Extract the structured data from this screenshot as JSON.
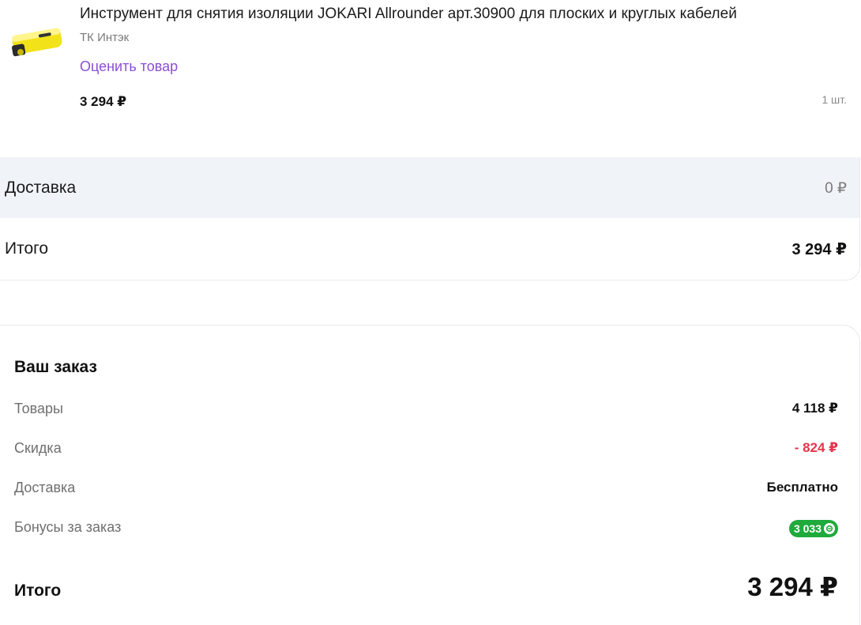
{
  "product": {
    "title": "Инструмент для снятия изоляции JOKARI Allrounder арт.30900 для плоских и круглых кабелей",
    "seller": "ТК Интэк",
    "rate_link": "Оценить товар",
    "price": "3 294 ₽",
    "quantity": "1 шт.",
    "image_icon": "cable-stripper-tool-image"
  },
  "summary": {
    "delivery_label": "Доставка",
    "delivery_value": "0 ₽",
    "total_label": "Итого",
    "total_value": "3 294 ₽"
  },
  "order": {
    "title": "Ваш заказ",
    "lines": [
      {
        "label": "Товары",
        "value": "4 118 ₽"
      },
      {
        "label": "Скидка",
        "value": "- 824 ₽"
      },
      {
        "label": "Доставка",
        "value": "Бесплатно"
      },
      {
        "label": "Бонусы за заказ",
        "value": "3 033"
      }
    ],
    "bonus_icon": "bonus-coin-icon",
    "total_label": "Итого",
    "total_value": "3 294 ₽"
  },
  "colors": {
    "link": "#8a4fd6",
    "discount": "#e8344a",
    "bonus": "#1faa3c",
    "delivery_bg": "#f0f3f7"
  }
}
